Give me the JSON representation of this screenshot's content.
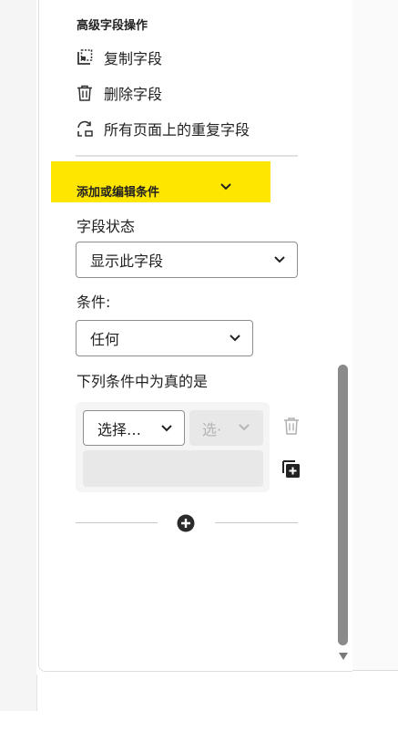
{
  "advanced": {
    "title": "高级字段操作",
    "copy_field": "复制字段",
    "delete_field": "删除字段",
    "duplicate_all_pages": "所有页面上的重复字段"
  },
  "conditions": {
    "title": "添加或编辑条件",
    "field_state_label": "字段状态",
    "field_state_value": "显示此字段",
    "condition_label": "条件:",
    "condition_value": "任何",
    "true_when_label": "下列条件中为真的是",
    "rule_field_select": "选择…",
    "rule_operator_select": "选·"
  },
  "colors": {
    "highlight": "#ffe600",
    "scrollbar": "#8a8a8a"
  }
}
